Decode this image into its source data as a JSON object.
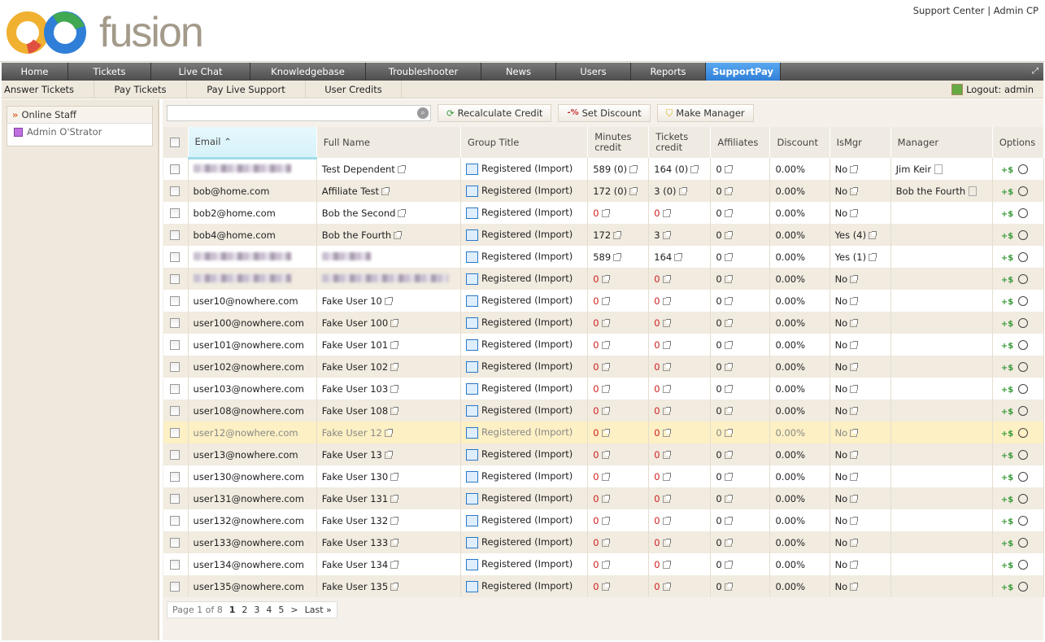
{
  "brand": "fusion",
  "toplinks": {
    "support": "Support Center",
    "sep": "|",
    "admin": "Admin CP"
  },
  "nav": [
    {
      "label": "Home"
    },
    {
      "label": "Tickets"
    },
    {
      "label": "Live Chat"
    },
    {
      "label": "Knowledgebase"
    },
    {
      "label": "Troubleshooter"
    },
    {
      "label": "News"
    },
    {
      "label": "Users"
    },
    {
      "label": "Reports"
    },
    {
      "label": "SupportPay",
      "active": true
    }
  ],
  "subnav": [
    {
      "label": "Answer Tickets"
    },
    {
      "label": "Pay Tickets"
    },
    {
      "label": "Pay Live Support"
    },
    {
      "label": "User Credits"
    }
  ],
  "logout": "Logout: admin",
  "sidebar": {
    "title": "Online Staff",
    "staff": "Admin O'Strator"
  },
  "toolbar": {
    "search_value": "",
    "recalc": "Recalculate Credit",
    "discount": "Set Discount",
    "manager": "Make Manager"
  },
  "columns": [
    "Email",
    "Full Name",
    "Group Title",
    "Minutes credit",
    "Tickets credit",
    "Affiliates",
    "Discount",
    "IsMgr",
    "Manager",
    "Options"
  ],
  "rows": [
    {
      "email": "",
      "name": "Test Dependent",
      "group": "Registered (Import)",
      "minutes": "589 (0)",
      "tickets": "164 (0)",
      "aff": "0",
      "disc": "0.00%",
      "ismgr": "No",
      "manager": "Jim Keir"
    },
    {
      "email": "bob@home.com",
      "name": "Affiliate Test",
      "group": "Registered (Import)",
      "minutes": "172 (0)",
      "tickets": "3 (0)",
      "aff": "0",
      "disc": "0.00%",
      "ismgr": "No",
      "manager": "Bob the Fourth"
    },
    {
      "email": "bob2@home.com",
      "name": "Bob the Second",
      "group": "Registered (Import)",
      "minutes": "0",
      "tickets": "0",
      "aff": "0",
      "disc": "0.00%",
      "ismgr": "No",
      "manager": ""
    },
    {
      "email": "bob4@home.com",
      "name": "Bob the Fourth",
      "group": "Registered (Import)",
      "minutes": "172",
      "tickets": "3",
      "aff": "0",
      "disc": "0.00%",
      "ismgr": "Yes (4)",
      "manager": ""
    },
    {
      "email": "",
      "name": "",
      "group": "Registered (Import)",
      "minutes": "589",
      "tickets": "164",
      "aff": "0",
      "disc": "0.00%",
      "ismgr": "Yes (1)",
      "manager": ""
    },
    {
      "email": "",
      "name": "",
      "group": "Registered (Import)",
      "minutes": "0",
      "tickets": "0",
      "aff": "0",
      "disc": "0.00%",
      "ismgr": "No",
      "manager": ""
    },
    {
      "email": "user10@nowhere.com",
      "name": "Fake User 10",
      "group": "Registered (Import)",
      "minutes": "0",
      "tickets": "0",
      "aff": "0",
      "disc": "0.00%",
      "ismgr": "No",
      "manager": ""
    },
    {
      "email": "user100@nowhere.com",
      "name": "Fake User 100",
      "group": "Registered (Import)",
      "minutes": "0",
      "tickets": "0",
      "aff": "0",
      "disc": "0.00%",
      "ismgr": "No",
      "manager": ""
    },
    {
      "email": "user101@nowhere.com",
      "name": "Fake User 101",
      "group": "Registered (Import)",
      "minutes": "0",
      "tickets": "0",
      "aff": "0",
      "disc": "0.00%",
      "ismgr": "No",
      "manager": ""
    },
    {
      "email": "user102@nowhere.com",
      "name": "Fake User 102",
      "group": "Registered (Import)",
      "minutes": "0",
      "tickets": "0",
      "aff": "0",
      "disc": "0.00%",
      "ismgr": "No",
      "manager": ""
    },
    {
      "email": "user103@nowhere.com",
      "name": "Fake User 103",
      "group": "Registered (Import)",
      "minutes": "0",
      "tickets": "0",
      "aff": "0",
      "disc": "0.00%",
      "ismgr": "No",
      "manager": ""
    },
    {
      "email": "user108@nowhere.com",
      "name": "Fake User 108",
      "group": "Registered (Import)",
      "minutes": "0",
      "tickets": "0",
      "aff": "0",
      "disc": "0.00%",
      "ismgr": "No",
      "manager": ""
    },
    {
      "email": "user12@nowhere.com",
      "name": "Fake User 12",
      "group": "Registered (Import)",
      "minutes": "0",
      "tickets": "0",
      "aff": "0",
      "disc": "0.00%",
      "ismgr": "No",
      "manager": "",
      "highlight": true
    },
    {
      "email": "user13@nowhere.com",
      "name": "Fake User 13",
      "group": "Registered (Import)",
      "minutes": "0",
      "tickets": "0",
      "aff": "0",
      "disc": "0.00%",
      "ismgr": "No",
      "manager": ""
    },
    {
      "email": "user130@nowhere.com",
      "name": "Fake User 130",
      "group": "Registered (Import)",
      "minutes": "0",
      "tickets": "0",
      "aff": "0",
      "disc": "0.00%",
      "ismgr": "No",
      "manager": ""
    },
    {
      "email": "user131@nowhere.com",
      "name": "Fake User 131",
      "group": "Registered (Import)",
      "minutes": "0",
      "tickets": "0",
      "aff": "0",
      "disc": "0.00%",
      "ismgr": "No",
      "manager": ""
    },
    {
      "email": "user132@nowhere.com",
      "name": "Fake User 132",
      "group": "Registered (Import)",
      "minutes": "0",
      "tickets": "0",
      "aff": "0",
      "disc": "0.00%",
      "ismgr": "No",
      "manager": ""
    },
    {
      "email": "user133@nowhere.com",
      "name": "Fake User 133",
      "group": "Registered (Import)",
      "minutes": "0",
      "tickets": "0",
      "aff": "0",
      "disc": "0.00%",
      "ismgr": "No",
      "manager": ""
    },
    {
      "email": "user134@nowhere.com",
      "name": "Fake User 134",
      "group": "Registered (Import)",
      "minutes": "0",
      "tickets": "0",
      "aff": "0",
      "disc": "0.00%",
      "ismgr": "No",
      "manager": ""
    },
    {
      "email": "user135@nowhere.com",
      "name": "Fake User 135",
      "group": "Registered (Import)",
      "minutes": "0",
      "tickets": "0",
      "aff": "0",
      "disc": "0.00%",
      "ismgr": "No",
      "manager": ""
    }
  ],
  "pager": {
    "label": "Page 1 of 8",
    "pages": [
      "1",
      "2",
      "3",
      "4",
      "5"
    ],
    "next": ">",
    "last": "Last »"
  },
  "colors": {
    "nav_active": "#2f7fd8",
    "zero": "#d02020",
    "highlight_row": "#fcf0c4"
  }
}
